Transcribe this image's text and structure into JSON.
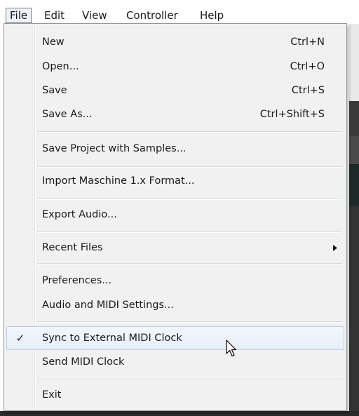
{
  "menubar": {
    "items": [
      {
        "label": "File"
      },
      {
        "label": "Edit"
      },
      {
        "label": "View"
      },
      {
        "label": "Controller"
      },
      {
        "label": "Help"
      }
    ]
  },
  "file_menu": {
    "new": {
      "label": "New",
      "shortcut": "Ctrl+N"
    },
    "open": {
      "label": "Open...",
      "shortcut": "Ctrl+O"
    },
    "save": {
      "label": "Save",
      "shortcut": "Ctrl+S"
    },
    "save_as": {
      "label": "Save As...",
      "shortcut": "Ctrl+Shift+S"
    },
    "save_project": {
      "label": "Save Project with Samples..."
    },
    "import": {
      "label": "Import Maschine 1.x Format..."
    },
    "export_audio": {
      "label": "Export Audio..."
    },
    "recent_files": {
      "label": "Recent Files"
    },
    "preferences": {
      "label": "Preferences..."
    },
    "audio_midi_settings": {
      "label": "Audio and MIDI Settings..."
    },
    "sync_midi_clock": {
      "label": "Sync to External MIDI Clock",
      "checked": true,
      "check_mark": "✓"
    },
    "send_midi_clock": {
      "label": "Send MIDI Clock"
    },
    "exit": {
      "label": "Exit"
    }
  },
  "icons": {
    "submenu_arrow": "submenu-arrow-icon",
    "mouse_cursor": "mouse-pointer-icon"
  },
  "colors": {
    "menu_background": "#f1f1f1",
    "hover_background": "#e6eef8",
    "hover_border": "#b8cde6",
    "active_menubar_border": "#7a7a7a"
  }
}
